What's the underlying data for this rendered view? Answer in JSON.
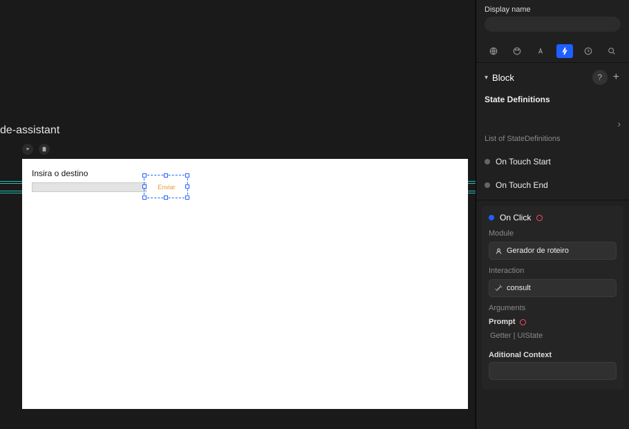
{
  "project": {
    "title": "de-assistant"
  },
  "artboard": {
    "label": "Insira o destino",
    "selected_button_text": "Enviar"
  },
  "inspector": {
    "display_name_label": "Display name",
    "display_name_value": "",
    "tabs": {
      "globe": "globe-icon",
      "palette": "palette-icon",
      "text": "text-icon",
      "bolt": "bolt-icon",
      "clock": "clock-icon",
      "search": "search-icon",
      "active": "bolt"
    },
    "block": {
      "header": "Block",
      "state_defs_title": "State Definitions",
      "state_defs_sub": "List of StateDefinitions"
    },
    "events": {
      "on_touch_start": "On Touch Start",
      "on_touch_end": "On Touch End",
      "on_click": "On Click"
    },
    "onclick": {
      "module_label": "Module",
      "module_value": "Gerador de roteiro",
      "interaction_label": "Interaction",
      "interaction_value": "consult",
      "arguments_label": "Arguments",
      "prompt_label": "Prompt",
      "prompt_value": "Getter | UIState",
      "additional_context_label": "Aditional Context",
      "additional_context_value": ""
    }
  }
}
